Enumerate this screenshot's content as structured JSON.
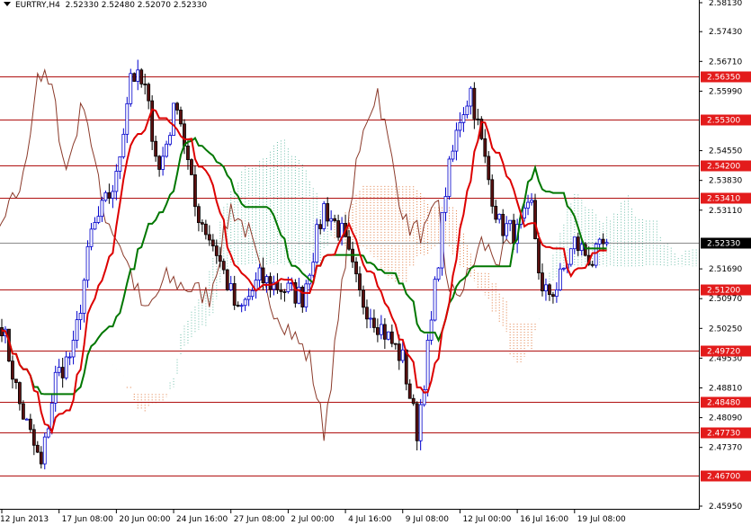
{
  "header": {
    "symbol": "EURTRY,H4",
    "ohlc": "2.52330 2.52480 2.52070 2.52330"
  },
  "colors": {
    "bull": "#0000cc",
    "bear": "#000000",
    "bear_fill": "#5a1010",
    "tenkan": "#dd0000",
    "kijun": "#007700",
    "chikou": "#8b3a2a",
    "cloud_up": "#6fbfaa",
    "cloud_down": "#e07a40",
    "level_line": "#b01010",
    "level_label_bg": "#e31b1b",
    "current_line": "#8a8a8a",
    "current_label_bg": "#000000"
  },
  "chart_data": {
    "type": "candlestick",
    "title": "EURTRY,H4",
    "indicator": "Ichimoku Kinko Hyo",
    "ylim": [
      2.4595,
      2.5813
    ],
    "price_ticks": [
      "2.58130",
      "2.57430",
      "2.56710",
      "2.55990",
      "2.54550",
      "2.53830",
      "2.53110",
      "2.51690",
      "2.50970",
      "2.50250",
      "2.49530",
      "2.48810",
      "2.48090",
      "2.47370",
      "2.45950"
    ],
    "time_labels": [
      {
        "bar": 0,
        "label": "12 Jun 2013"
      },
      {
        "bar": 16,
        "label": "17 Jun 08:00"
      },
      {
        "bar": 32,
        "label": "20 Jun 00:00"
      },
      {
        "bar": 48,
        "label": "24 Jun 16:00"
      },
      {
        "bar": 64,
        "label": "27 Jun 08:00"
      },
      {
        "bar": 80,
        "label": "2 Jul 00:00"
      },
      {
        "bar": 96,
        "label": "4 Jul 16:00"
      },
      {
        "bar": 112,
        "label": "9 Jul 08:00"
      },
      {
        "bar": 128,
        "label": "12 Jul 00:00"
      },
      {
        "bar": 144,
        "label": "16 Jul 16:00"
      },
      {
        "bar": 160,
        "label": "19 Jul 08:00"
      }
    ],
    "levels": [
      "2.56350",
      "2.55300",
      "2.54200",
      "2.53410",
      "2.51200",
      "2.49720",
      "2.48480",
      "2.47730",
      "2.46700"
    ],
    "current_price": "2.52330",
    "bar_count": 170,
    "close_path": [
      [
        0,
        2.5037
      ],
      [
        5,
        2.4841
      ],
      [
        11,
        2.4689
      ],
      [
        15,
        2.4906
      ],
      [
        20,
        2.4971
      ],
      [
        25,
        2.5254
      ],
      [
        32,
        2.5385
      ],
      [
        36,
        2.5646
      ],
      [
        40,
        2.5602
      ],
      [
        44,
        2.5406
      ],
      [
        49,
        2.558
      ],
      [
        54,
        2.5319
      ],
      [
        60,
        2.5211
      ],
      [
        66,
        2.5058
      ],
      [
        72,
        2.5145
      ],
      [
        78,
        2.5124
      ],
      [
        84,
        2.5102
      ],
      [
        90,
        2.5319
      ],
      [
        95,
        2.5254
      ],
      [
        100,
        2.5102
      ],
      [
        107,
        2.5015
      ],
      [
        112,
        2.495
      ],
      [
        116,
        2.4776
      ],
      [
        120,
        2.5037
      ],
      [
        124,
        2.5363
      ],
      [
        128,
        2.5537
      ],
      [
        131,
        2.5602
      ],
      [
        136,
        2.5385
      ],
      [
        139,
        2.5276
      ],
      [
        144,
        2.5254
      ],
      [
        148,
        2.5319
      ],
      [
        151,
        2.5102
      ],
      [
        155,
        2.5124
      ],
      [
        160,
        2.5232
      ],
      [
        165,
        2.5189
      ],
      [
        169,
        2.5233
      ]
    ]
  }
}
